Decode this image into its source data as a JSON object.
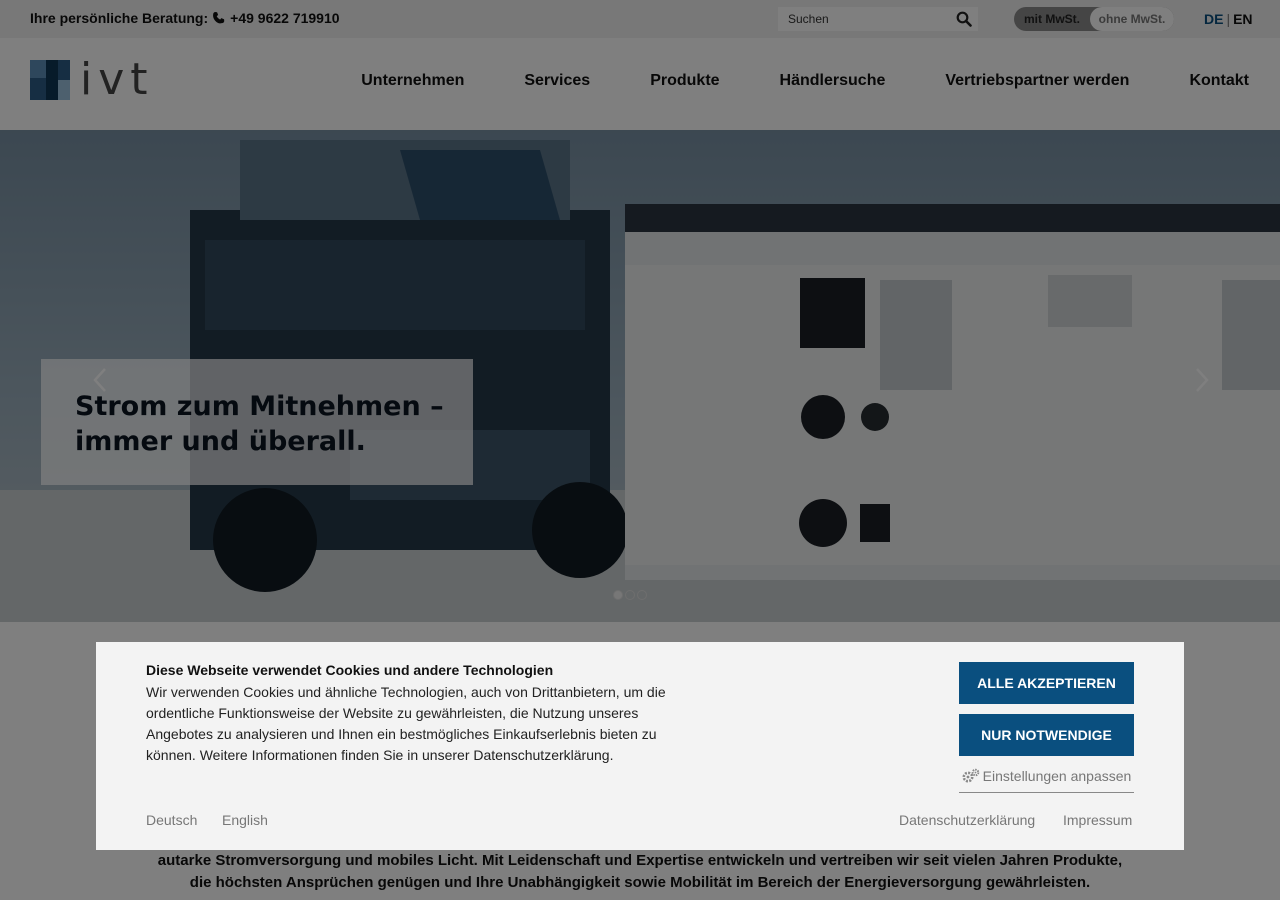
{
  "topbar": {
    "phone_label": "Ihre persönliche Beratung:",
    "phone_number": "+49 9622 719910",
    "search_placeholder": "Suchen",
    "vat_with": "mit MwSt.",
    "vat_without": "ohne MwSt.",
    "lang_de": "DE",
    "lang_sep": "|",
    "lang_en": "EN"
  },
  "header": {
    "logo_text": "ivt",
    "nav": [
      "Unternehmen",
      "Services",
      "Produkte",
      "Händlersuche",
      "Vertriebspartner werden",
      "Kontakt"
    ]
  },
  "hero": {
    "headline": "Strom zum Mitnehmen – immer und überall."
  },
  "intro": {
    "line1": "autarke Stromversorgung und mobiles Licht. Mit Leidenschaft und Expertise entwickeln und vertreiben wir seit vielen Jahren Produkte,",
    "line2": "die höchsten Ansprüchen genügen und Ihre Unabhängigkeit sowie Mobilität im Bereich der Energieversorgung gewährleisten."
  },
  "cookie": {
    "title": "Diese Webseite verwendet Cookies und andere Technologien",
    "text": "Wir verwenden Cookies und ähnliche Technologien, auch von Drittanbietern, um die ordentliche Funktionsweise der Website zu gewährleisten, die Nutzung unseres Angebotes zu analysieren und Ihnen ein bestmögliches Einkaufserlebnis bieten zu können. Weitere Informationen finden Sie in unserer Datenschutzerklärung.",
    "accept_all": "ALLE AKZEPTIEREN",
    "only_necessary": "NUR NOTWENDIGE",
    "settings": "Einstellungen anpassen",
    "lang_de": "Deutsch",
    "lang_en": "English",
    "privacy": "Datenschutzerklärung",
    "imprint": "Impressum"
  },
  "colors": {
    "brand_blue": "#0a4f7f",
    "topbar_bg": "#f0f0f0",
    "dialog_bg": "#f3f3f3"
  }
}
